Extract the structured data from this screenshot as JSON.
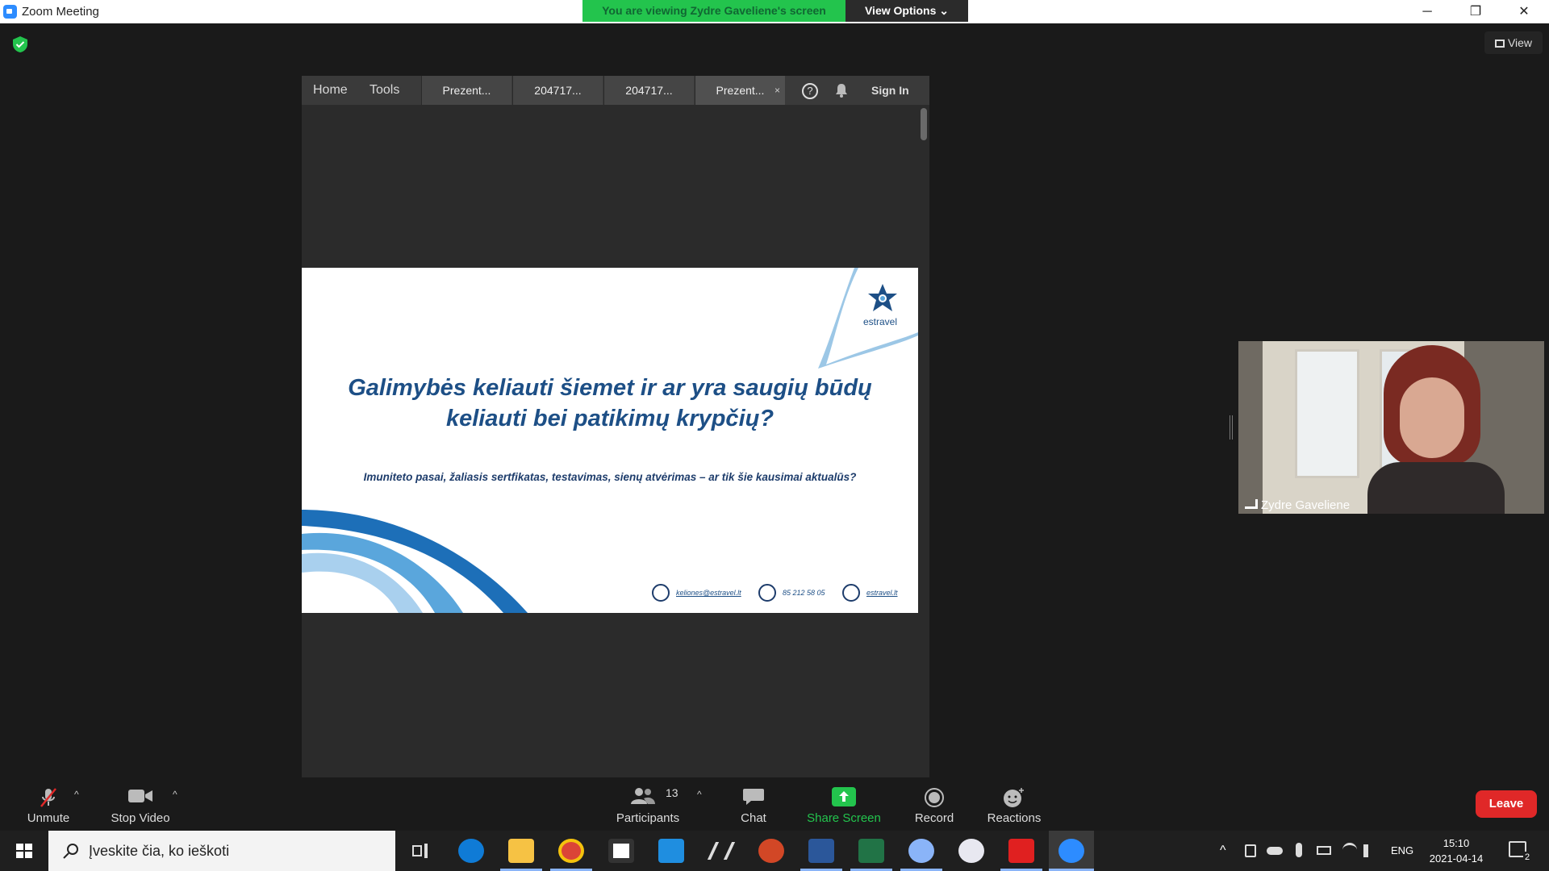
{
  "window": {
    "title": "Zoom Meeting"
  },
  "banner": {
    "viewing_text": "You are viewing Zydre Gaveliene's screen",
    "view_options_label": "View Options ⌄"
  },
  "window_controls": {
    "minimize": "─",
    "restore": "❐",
    "close": "✕"
  },
  "view_button": {
    "label": "View"
  },
  "acrobat": {
    "nav": [
      "Home",
      "Tools"
    ],
    "tabs": [
      {
        "label": "Prezent...",
        "active": false
      },
      {
        "label": "204717...",
        "active": false
      },
      {
        "label": "204717...",
        "active": false
      },
      {
        "label": "Prezent...",
        "active": true
      }
    ],
    "tab_close": "×",
    "help_icon": "?",
    "sign_in": "Sign In"
  },
  "slide": {
    "title_line1": "Galimybės keliauti šiemet ir ar yra saugių būdų",
    "title_line2": "keliauti bei patikimų krypčių?",
    "subtitle": "Imuniteto pasai, žaliasis sertfikatas, testavimas, sienų atvėrimas – ar tik šie kausimai aktualūs?",
    "logo_text": "estravel",
    "email": "keliones@estravel.lt",
    "phone": "85 212 58 05",
    "website": "estravel.lt"
  },
  "video": {
    "participant_name": "Zydre Gaveliene"
  },
  "toolbar": {
    "unmute": "Unmute",
    "stop_video": "Stop Video",
    "participants": "Participants",
    "participants_count": "13",
    "chat": "Chat",
    "share_screen": "Share Screen",
    "record": "Record",
    "reactions": "Reactions",
    "leave": "Leave",
    "caret": "^"
  },
  "taskbar": {
    "search_placeholder": "Įveskite čia, ko ieškoti",
    "language": "ENG",
    "time": "15:10",
    "date": "2021-04-14",
    "notification_count": "2"
  },
  "colors": {
    "zoom_blue": "#2d8cff",
    "banner_green": "#23c44d",
    "leave_red": "#e02828",
    "share_green": "#23c44d"
  }
}
